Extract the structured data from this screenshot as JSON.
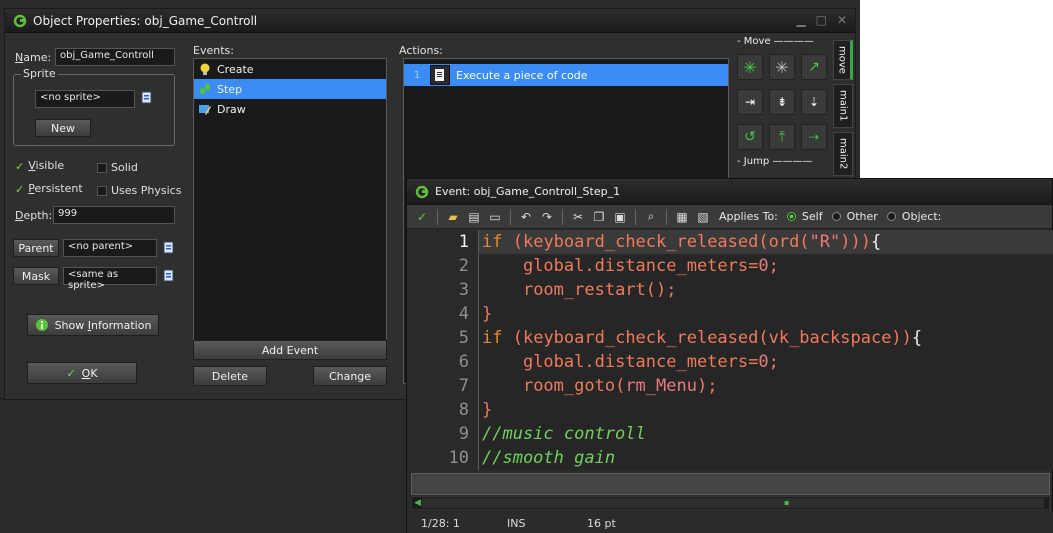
{
  "object_window": {
    "title": "Object Properties: obj_Game_Controll",
    "name_label": "Name:",
    "name_value": "obj_Game_Controll",
    "sprite_label": "Sprite",
    "sprite_value": "<no sprite>",
    "new_button": "New",
    "visible_label": "Visible",
    "solid_label": "Solid",
    "persistent_label": "Persistent",
    "uses_physics_label": "Uses Physics",
    "depth_label": "Depth:",
    "depth_value": "999",
    "parent_button": "Parent",
    "parent_value": "<no parent>",
    "mask_button": "Mask",
    "mask_value": "<same as sprite>",
    "show_info_button": "Show Information",
    "ok_button": "OK",
    "checkboxes": {
      "visible": true,
      "solid": false,
      "persistent": true,
      "uses_physics": false
    }
  },
  "events_panel": {
    "label": "Events:",
    "items": [
      {
        "label": "Create",
        "selected": false,
        "icon": "lightbulb-icon"
      },
      {
        "label": "Step",
        "selected": true,
        "icon": "footsteps-icon"
      },
      {
        "label": "Draw",
        "selected": false,
        "icon": "paint-icon"
      }
    ],
    "add_event_button": "Add Event",
    "delete_button": "Delete",
    "change_button": "Change"
  },
  "actions_panel": {
    "label": "Actions:",
    "items": [
      {
        "number": "1",
        "label": "Execute a piece of code",
        "icon": "code-page-icon"
      }
    ]
  },
  "palette": {
    "move_section": "Move",
    "jump_section": "Jump",
    "tabs": [
      "move",
      "main1",
      "main2"
    ],
    "accent": "#3aa64a"
  },
  "code_window": {
    "title": "Event: obj_Game_Controll_Step_1",
    "applies_to_label": "Applies To:",
    "applies_self": "Self",
    "applies_other": "Other",
    "applies_object": "Object:",
    "applies_selected": "Self",
    "line_numbers": [
      "1",
      "2",
      "3",
      "4",
      "5",
      "6",
      "7",
      "8",
      "9",
      "10"
    ],
    "status_position": "1/28: 1",
    "status_mode": "INS",
    "status_size": "16 pt"
  },
  "colors": {
    "selection": "#3c8cf5",
    "keyword": "#e88a2a",
    "function": "#f07a5a",
    "comment": "#6fd15b",
    "background": "#2b2b2b"
  }
}
